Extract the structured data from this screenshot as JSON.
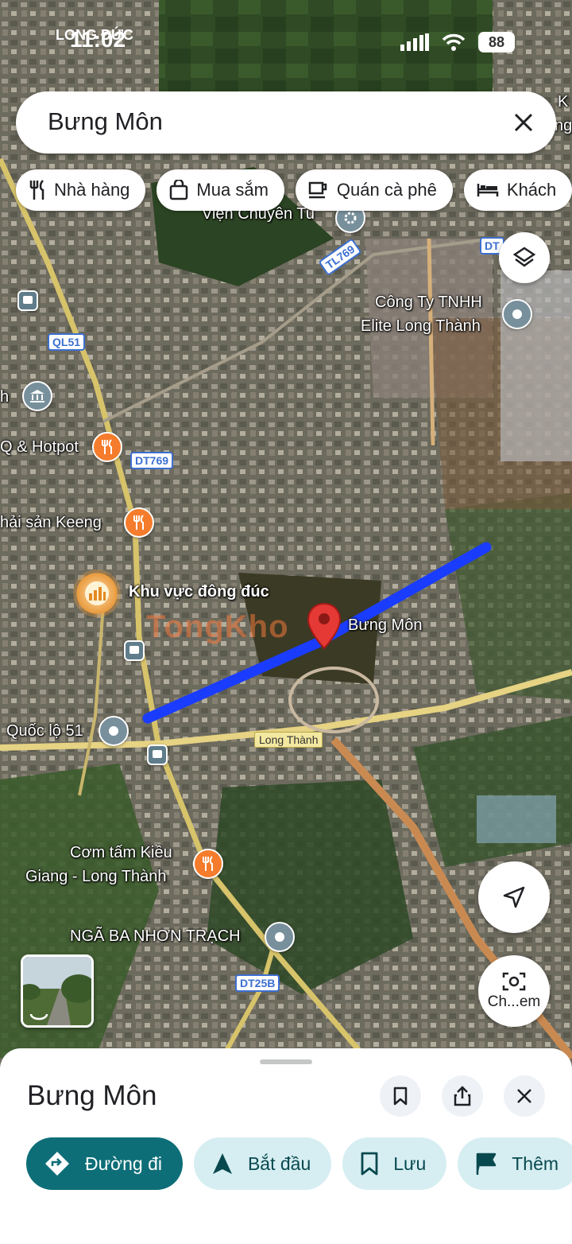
{
  "status_bar": {
    "time": "11:02",
    "overlay_label": "LONG ĐỨC",
    "battery": "88"
  },
  "search": {
    "query": "Bưng Môn",
    "close_icon": "close-icon"
  },
  "chips": [
    {
      "label": "Nhà hàng",
      "icon": "restaurant-icon"
    },
    {
      "label": "Mua sắm",
      "icon": "shopping-bag-icon"
    },
    {
      "label": "Quán cà phê",
      "icon": "coffee-icon"
    },
    {
      "label": "Khách",
      "icon": "hotel-bed-icon"
    }
  ],
  "map": {
    "labels": {
      "vien_chuyen_tu": "Viện Chuyên Tu",
      "cong_ty": "Công Ty TNHH",
      "elite": "Elite Long Thành",
      "hotpot": "Q & Hotpot",
      "keeng": "hải sản Keeng",
      "crowded": "Khu vực đông đúc",
      "bung_mon": "Bưng Môn",
      "quoc_lo": "Quốc lộ 51",
      "com_tam_1": "Cơm tấm Kiều",
      "com_tam_2": "Giang - Long Thành",
      "nga_ba": "NGÃ BA NHƠN TRẠCH",
      "h_fragment": "h",
      "k_fragment": "K",
      "ng_fragment": "ng"
    },
    "shields": {
      "ql51": "QL51",
      "dt769": "DT769",
      "tl769": "TL769",
      "dt25b": "DT25B",
      "dt_fragment": "DT"
    },
    "place_tag": "Long Thành",
    "watermark": "TongKho"
  },
  "fabs": {
    "layers_icon": "layers-icon",
    "locate_icon": "navigation-arrow-icon",
    "lens_label": "Ch...em",
    "lens_icon": "camera-search-icon"
  },
  "sheet": {
    "title": "Bưng Môn",
    "actions": [
      {
        "label": "Đường đi",
        "icon": "directions-icon",
        "primary": true
      },
      {
        "label": "Bắt đầu",
        "icon": "navigation-start-icon",
        "primary": false
      },
      {
        "label": "Lưu",
        "icon": "bookmark-icon",
        "primary": false
      },
      {
        "label": "Thêm",
        "icon": "flag-icon",
        "primary": false
      }
    ]
  },
  "colors": {
    "route": "#1a3cff",
    "pin": "#e53935",
    "primary_action": "#0e6e78",
    "secondary_action": "#d6eef2"
  }
}
